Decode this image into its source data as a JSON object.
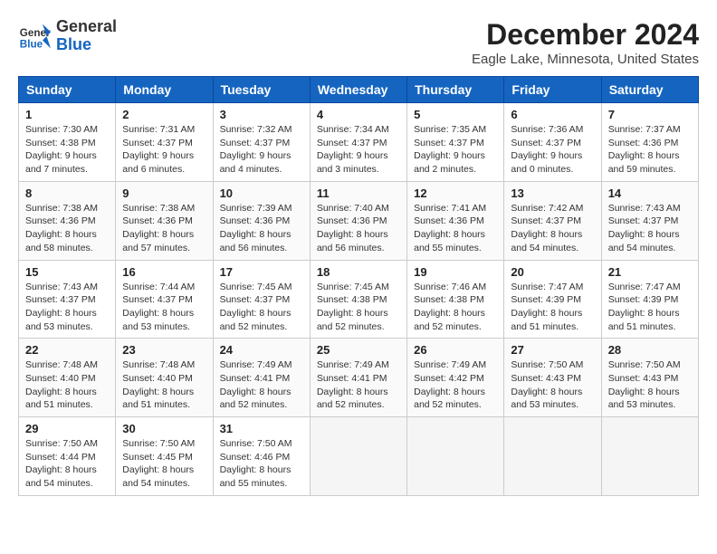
{
  "header": {
    "logo_line1": "General",
    "logo_line2": "Blue",
    "main_title": "December 2024",
    "subtitle": "Eagle Lake, Minnesota, United States"
  },
  "weekdays": [
    "Sunday",
    "Monday",
    "Tuesday",
    "Wednesday",
    "Thursday",
    "Friday",
    "Saturday"
  ],
  "weeks": [
    [
      {
        "day": "1",
        "sunrise": "7:30 AM",
        "sunset": "4:38 PM",
        "daylight": "9 hours and 7 minutes."
      },
      {
        "day": "2",
        "sunrise": "7:31 AM",
        "sunset": "4:37 PM",
        "daylight": "9 hours and 6 minutes."
      },
      {
        "day": "3",
        "sunrise": "7:32 AM",
        "sunset": "4:37 PM",
        "daylight": "9 hours and 4 minutes."
      },
      {
        "day": "4",
        "sunrise": "7:34 AM",
        "sunset": "4:37 PM",
        "daylight": "9 hours and 3 minutes."
      },
      {
        "day": "5",
        "sunrise": "7:35 AM",
        "sunset": "4:37 PM",
        "daylight": "9 hours and 2 minutes."
      },
      {
        "day": "6",
        "sunrise": "7:36 AM",
        "sunset": "4:37 PM",
        "daylight": "9 hours and 0 minutes."
      },
      {
        "day": "7",
        "sunrise": "7:37 AM",
        "sunset": "4:36 PM",
        "daylight": "8 hours and 59 minutes."
      }
    ],
    [
      {
        "day": "8",
        "sunrise": "7:38 AM",
        "sunset": "4:36 PM",
        "daylight": "8 hours and 58 minutes."
      },
      {
        "day": "9",
        "sunrise": "7:38 AM",
        "sunset": "4:36 PM",
        "daylight": "8 hours and 57 minutes."
      },
      {
        "day": "10",
        "sunrise": "7:39 AM",
        "sunset": "4:36 PM",
        "daylight": "8 hours and 56 minutes."
      },
      {
        "day": "11",
        "sunrise": "7:40 AM",
        "sunset": "4:36 PM",
        "daylight": "8 hours and 56 minutes."
      },
      {
        "day": "12",
        "sunrise": "7:41 AM",
        "sunset": "4:36 PM",
        "daylight": "8 hours and 55 minutes."
      },
      {
        "day": "13",
        "sunrise": "7:42 AM",
        "sunset": "4:37 PM",
        "daylight": "8 hours and 54 minutes."
      },
      {
        "day": "14",
        "sunrise": "7:43 AM",
        "sunset": "4:37 PM",
        "daylight": "8 hours and 54 minutes."
      }
    ],
    [
      {
        "day": "15",
        "sunrise": "7:43 AM",
        "sunset": "4:37 PM",
        "daylight": "8 hours and 53 minutes."
      },
      {
        "day": "16",
        "sunrise": "7:44 AM",
        "sunset": "4:37 PM",
        "daylight": "8 hours and 53 minutes."
      },
      {
        "day": "17",
        "sunrise": "7:45 AM",
        "sunset": "4:37 PM",
        "daylight": "8 hours and 52 minutes."
      },
      {
        "day": "18",
        "sunrise": "7:45 AM",
        "sunset": "4:38 PM",
        "daylight": "8 hours and 52 minutes."
      },
      {
        "day": "19",
        "sunrise": "7:46 AM",
        "sunset": "4:38 PM",
        "daylight": "8 hours and 52 minutes."
      },
      {
        "day": "20",
        "sunrise": "7:47 AM",
        "sunset": "4:39 PM",
        "daylight": "8 hours and 51 minutes."
      },
      {
        "day": "21",
        "sunrise": "7:47 AM",
        "sunset": "4:39 PM",
        "daylight": "8 hours and 51 minutes."
      }
    ],
    [
      {
        "day": "22",
        "sunrise": "7:48 AM",
        "sunset": "4:40 PM",
        "daylight": "8 hours and 51 minutes."
      },
      {
        "day": "23",
        "sunrise": "7:48 AM",
        "sunset": "4:40 PM",
        "daylight": "8 hours and 51 minutes."
      },
      {
        "day": "24",
        "sunrise": "7:49 AM",
        "sunset": "4:41 PM",
        "daylight": "8 hours and 52 minutes."
      },
      {
        "day": "25",
        "sunrise": "7:49 AM",
        "sunset": "4:41 PM",
        "daylight": "8 hours and 52 minutes."
      },
      {
        "day": "26",
        "sunrise": "7:49 AM",
        "sunset": "4:42 PM",
        "daylight": "8 hours and 52 minutes."
      },
      {
        "day": "27",
        "sunrise": "7:50 AM",
        "sunset": "4:43 PM",
        "daylight": "8 hours and 53 minutes."
      },
      {
        "day": "28",
        "sunrise": "7:50 AM",
        "sunset": "4:43 PM",
        "daylight": "8 hours and 53 minutes."
      }
    ],
    [
      {
        "day": "29",
        "sunrise": "7:50 AM",
        "sunset": "4:44 PM",
        "daylight": "8 hours and 54 minutes."
      },
      {
        "day": "30",
        "sunrise": "7:50 AM",
        "sunset": "4:45 PM",
        "daylight": "8 hours and 54 minutes."
      },
      {
        "day": "31",
        "sunrise": "7:50 AM",
        "sunset": "4:46 PM",
        "daylight": "8 hours and 55 minutes."
      },
      null,
      null,
      null,
      null
    ]
  ]
}
